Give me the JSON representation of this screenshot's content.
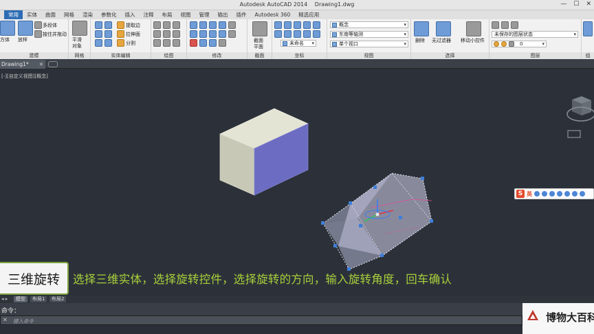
{
  "window": {
    "app_title": "Autodesk AutoCAD 2014",
    "file_title": "Drawing1.dwg",
    "minimize": "—",
    "maximize": "☐",
    "close": "✕"
  },
  "ribbon_tabs": [
    "常用",
    "实体",
    "曲面",
    "网格",
    "渲染",
    "参数化",
    "插入",
    "注释",
    "布局",
    "视图",
    "管理",
    "输出",
    "插件",
    "Autodesk 360",
    "精选应用"
  ],
  "ribbon": {
    "modeling": {
      "label": "建模",
      "box": "方体",
      "extrude": "放样",
      "polysolid": "多段体",
      "presspull": "按住并拖动"
    },
    "mesh": {
      "label": "网格",
      "smooth_object": "平滑",
      "object": "对象"
    },
    "solid_editing": {
      "label": "实体编辑",
      "extract_edges": "提取边",
      "extrude_faces": "拉伸面",
      "separate": "分割"
    },
    "draw": {
      "label": "绘图"
    },
    "modify": {
      "label": "修改"
    },
    "section": {
      "label": "截面",
      "section_plane": "截面",
      "plane": "平面"
    },
    "coordinates": {
      "label": "坐标",
      "ucs_unnamed": "未命名"
    },
    "view": {
      "label": "视图",
      "visual_style": "概念",
      "view_direction": "东南等轴测",
      "viewport": "单个视口"
    },
    "selection": {
      "label": "选择",
      "delete": "删除",
      "no_filter": "无过滤器",
      "move_gizmo": "移动小控件"
    },
    "layers": {
      "label": "图层",
      "layer_state": "未保存的图层状态",
      "current_layer": "0"
    },
    "extra": {
      "label": "组"
    }
  },
  "file_tab": {
    "name": "Drawing1*",
    "close": "✕"
  },
  "viewport": {
    "label": "[-][自定义视图][概念]"
  },
  "caption": {
    "title": "三维旋转",
    "instruction": "选择三维实体，选择旋转控件，选择旋转的方向，输入旋转角度，回车确认"
  },
  "ime": {
    "logo": "S",
    "lang": "英"
  },
  "layout_tabs": [
    "模型",
    "布局1",
    "布局2"
  ],
  "command": {
    "history": "命令：",
    "close": "✕",
    "placeholder": "键入命令"
  },
  "watermark": {
    "text": "博物大百科"
  },
  "colors": {
    "viewport_bg": "#2c3139",
    "box_top": "#e4e4d4",
    "box_front": "#c8c8b6",
    "box_side": "#6c6cc2",
    "accent_tab": "#2e6db5",
    "caption_text": "#a8cf3a",
    "caption_border": "#7aa33c"
  }
}
